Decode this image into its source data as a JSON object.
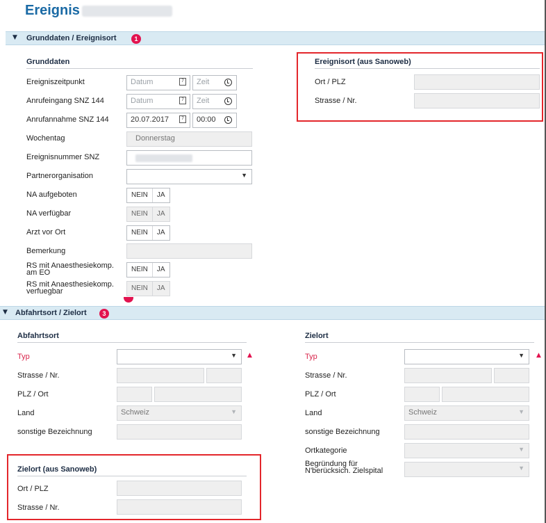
{
  "page": {
    "title": "Ereignis"
  },
  "section1": {
    "title": "Grunddaten / Ereignisort",
    "badge": "1",
    "grunddaten": {
      "heading": "Grunddaten",
      "ereigniszeitpunkt": {
        "label": "Ereigniszeitpunkt",
        "date_placeholder": "Datum",
        "time_placeholder": "Zeit"
      },
      "anrufeingang": {
        "label": "Anrufeingang SNZ 144",
        "date_placeholder": "Datum",
        "time_placeholder": "Zeit"
      },
      "anrufannahme": {
        "label": "Anrufannahme SNZ 144",
        "date_value": "20.07.2017",
        "time_value": "00:00"
      },
      "wochentag": {
        "label": "Wochentag",
        "value": "Donnerstag"
      },
      "ereignisnummer": {
        "label": "Ereignisnummer SNZ"
      },
      "partnerorganisation": {
        "label": "Partnerorganisation",
        "value": ""
      },
      "na_aufgeboten": {
        "label": "NA aufgeboten",
        "no": "NEIN",
        "yes": "JA"
      },
      "na_verfuegbar": {
        "label": "NA verfügbar",
        "no": "NEIN",
        "yes": "JA"
      },
      "arzt_vor_ort": {
        "label": "Arzt vor Ort",
        "no": "NEIN",
        "yes": "JA"
      },
      "bemerkung": {
        "label": "Bemerkung"
      },
      "rs_am_eo": {
        "label_line1": "RS mit Anaesthesiekomp.",
        "label_line2": "am EO",
        "no": "NEIN",
        "yes": "JA"
      },
      "rs_verfuegbar": {
        "label_line1": "RS mit Anaesthesiekomp.",
        "label_line2": "verfuegbar",
        "no": "NEIN",
        "yes": "JA"
      }
    },
    "ereignisort": {
      "heading": "Ereignisort (aus Sanoweb)",
      "ort_plz": {
        "label": "Ort / PLZ"
      },
      "strasse": {
        "label": "Strasse / Nr."
      }
    }
  },
  "section2": {
    "title": "Abfahrtsort / Zielort",
    "badge": "3",
    "abfahrtsort": {
      "heading": "Abfahrtsort",
      "typ": {
        "label": "Typ",
        "value": ""
      },
      "strasse": {
        "label": "Strasse / Nr."
      },
      "plz_ort": {
        "label": "PLZ / Ort"
      },
      "land": {
        "label": "Land",
        "value": "Schweiz"
      },
      "sonstige": {
        "label": "sonstige Bezeichnung"
      }
    },
    "zielort": {
      "heading": "Zielort",
      "typ": {
        "label": "Typ",
        "value": ""
      },
      "strasse": {
        "label": "Strasse / Nr."
      },
      "plz_ort": {
        "label": "PLZ / Ort"
      },
      "land": {
        "label": "Land",
        "value": "Schweiz"
      },
      "sonstige": {
        "label": "sonstige Bezeichnung"
      },
      "ortkategorie": {
        "label": "Ortkategorie"
      },
      "begruendung": {
        "label_line1": "Begründung für",
        "label_line2": "N'berücksich. Zielspital"
      }
    },
    "zielort_sanoweb": {
      "heading": "Zielort (aus Sanoweb)",
      "ort_plz": {
        "label": "Ort / PLZ"
      },
      "strasse": {
        "label": "Strasse / Nr."
      }
    }
  },
  "colors": {
    "accent": "#1a6aa5",
    "section_bar": "#d9eaf3",
    "badge": "#e2134f",
    "highlight_box": "#e3262b",
    "required_label": "#d9254b"
  },
  "icons": [
    "calendar-icon",
    "clock-icon",
    "chevron-down-icon",
    "collapse-triangle-icon",
    "required-warning-icon"
  ]
}
